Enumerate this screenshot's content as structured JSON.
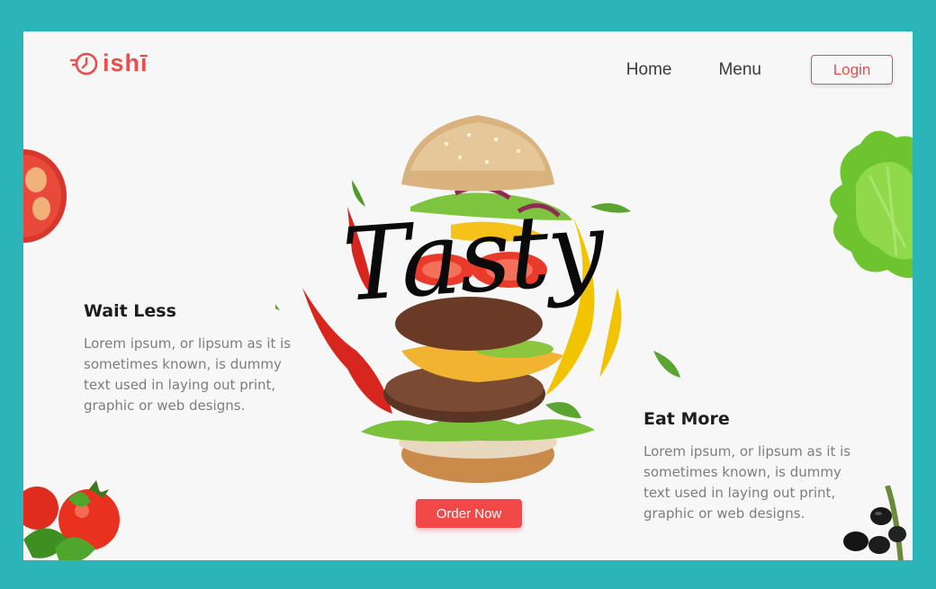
{
  "brand": {
    "name": "ishī"
  },
  "nav": {
    "home": "Home",
    "menu": "Menu",
    "login": "Login"
  },
  "hero": {
    "headline": "Tasty",
    "cta": "Order Now"
  },
  "features": {
    "left": {
      "title": "Wait Less",
      "text": "Lorem ipsum, or lipsum as it is sometimes known, is dummy text used in laying out print, graphic or web designs."
    },
    "right": {
      "title": "Eat More",
      "text": "Lorem ipsum, or lipsum as it is sometimes known, is dummy text used in laying out print, graphic or web designs."
    }
  },
  "colors": {
    "background": "#2bb5b9",
    "card": "#f7f7f7",
    "accent": "#ee4b4b",
    "button": "#f24848"
  },
  "icons": [
    "logo-clock-icon",
    "burger-image",
    "tomato-slice-image",
    "lettuce-image",
    "tomatoes-basil-image",
    "olives-image"
  ]
}
